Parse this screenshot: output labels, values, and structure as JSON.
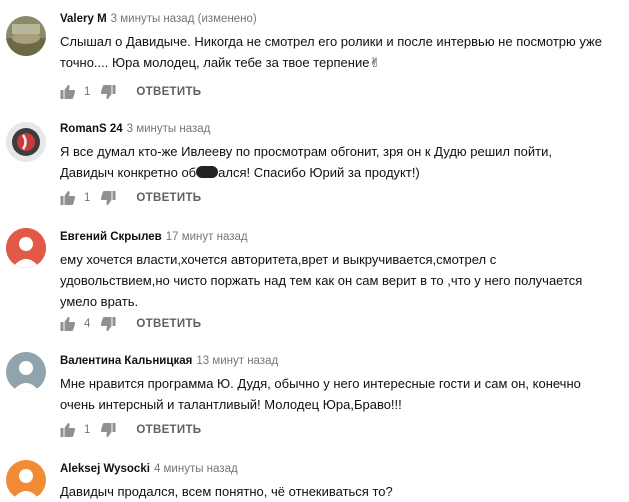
{
  "comments": [
    {
      "author": "Valery M",
      "time": "3 минуты назад (изменено)",
      "lines": [
        "Слышал о Давидыче. Никогда не смотрел его ролики и после интервью  не посмотрю уже",
        "точно.... Юра молодец, лайк тебе за твое терпение"
      ],
      "emoji": "✌",
      "likes": "1",
      "reply": "ОТВЕТИТЬ"
    },
    {
      "author": "RomanS 24",
      "time": "3 минуты назад",
      "lines": [
        "Я все думал кто-же Ивлееву по просмотрам обгонит, зря он к Дудю решил пойти,",
        "Давидыч конкретно об",
        "ался! Спасибо Юрий за продукт!)"
      ],
      "likes": "1",
      "reply": "ОТВЕТИТЬ"
    },
    {
      "author": "Евгений Скрылев",
      "time": "17 минут назад",
      "lines": [
        "ему хочется власти,хочется авторитета,врет и выкручивается,смотрел с",
        "удовольствием,но чисто поржать над тем как он сам верит в то ,что у него получается",
        "умело врать."
      ],
      "likes": "4",
      "reply": "ОТВЕТИТЬ"
    },
    {
      "author": "Валентина Кальницкая",
      "time": "13 минут назад",
      "lines": [
        "Мне нравится программа  Ю. Дудя,  обычно у него интересные гости и сам он, конечно",
        "очень интерсный и  талантливый!  Молодец Юра,Браво!!!"
      ],
      "likes": "1",
      "reply": "ОТВЕТИТЬ"
    },
    {
      "author": "Aleksej Wysocki",
      "time": "4 минуты назад",
      "lines": [
        "Давидыч продался, всем понятно, чё отнекиваться то?"
      ]
    }
  ],
  "icons": {
    "like": "thumbs-up-icon",
    "dislike": "thumbs-down-icon"
  },
  "colors": {
    "author": "#111111",
    "time": "#767676",
    "reply": "#606060",
    "avatar_evgeny": "#e05a47",
    "avatar_generic": "#90a4ae",
    "avatar_aleksej": "#f28b36"
  }
}
